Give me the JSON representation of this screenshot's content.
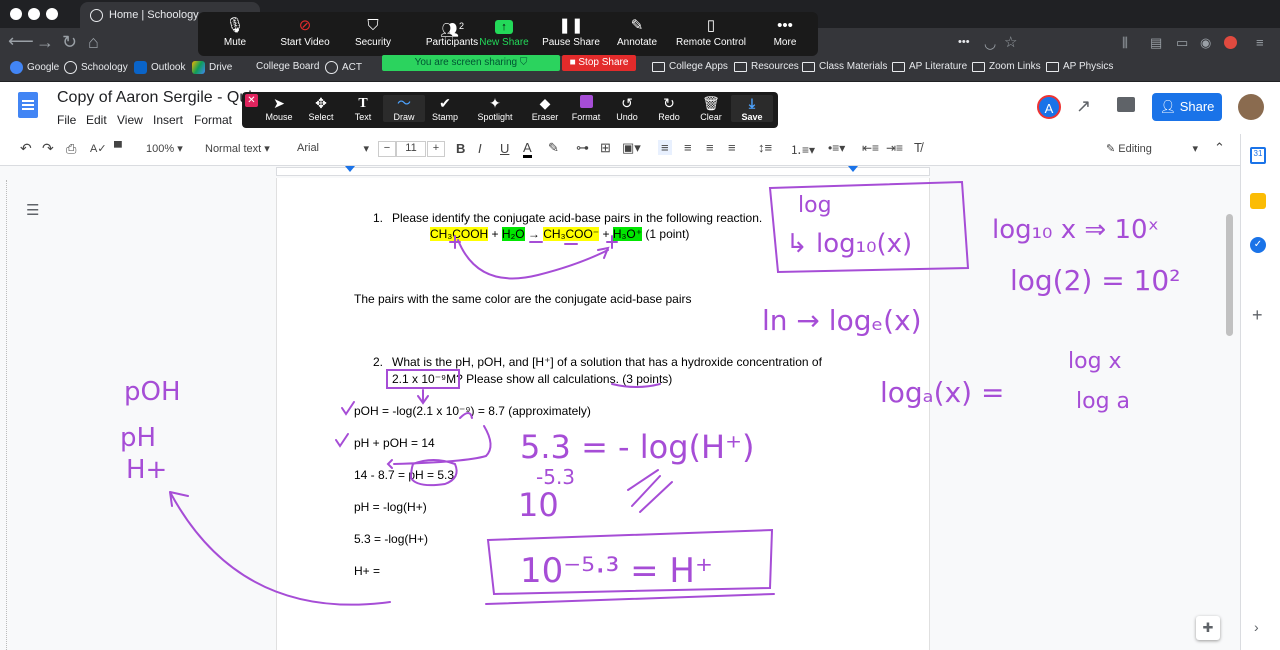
{
  "browser": {
    "tabs": [
      "Home | Schoology",
      "",
      ""
    ],
    "bookmarks": [
      "Google",
      "Schoology",
      "Outlook",
      "Drive",
      "College Board",
      "ACT",
      "College Apps",
      "Resources",
      "Class Materials",
      "AP Literature",
      "Zoom Links",
      "AP Physics"
    ],
    "more": "•••"
  },
  "zoom": {
    "buttons": [
      {
        "label": "Mute",
        "icon": "mic-icon"
      },
      {
        "label": "Start Video",
        "icon": "video-off-icon"
      },
      {
        "label": "Security",
        "icon": "shield-icon"
      },
      {
        "label": "Participants",
        "icon": "people-icon",
        "count": "2"
      },
      {
        "label": "New Share",
        "icon": "share-up-icon"
      },
      {
        "label": "Pause Share",
        "icon": "pause-icon"
      },
      {
        "label": "Annotate",
        "icon": "pen-icon"
      },
      {
        "label": "Remote Control",
        "icon": "mouse-icon"
      },
      {
        "label": "More",
        "icon": "more-icon"
      }
    ],
    "sharing_text": "You are screen sharing",
    "stop_share": "Stop Share",
    "annotate_tools": [
      "Mouse",
      "Select",
      "Text",
      "Draw",
      "Stamp",
      "Spotlight",
      "Eraser",
      "Format",
      "Undo",
      "Redo",
      "Clear",
      "Save"
    ]
  },
  "docs": {
    "title": "Copy of Aaron Sergile - Quiz",
    "menu": [
      "File",
      "Edit",
      "View",
      "Insert",
      "Format"
    ],
    "avatar_letter": "A",
    "share": "Share",
    "zoom": "100%",
    "style": "Normal text",
    "font": "Arial",
    "size": "11",
    "mode": "Editing"
  },
  "content": {
    "q1_num": "1.",
    "q1": "Please identify the conjugate acid-base pairs in the following reaction.",
    "eq": {
      "a": "CH₃COOH",
      "plus1": " + ",
      "b": "H₂O",
      "arrow": " → ",
      "c": "CH₃COO⁻",
      "plus2": " + ",
      "d": "H₃O⁺",
      "pts": " (1 point)"
    },
    "pairs": "The pairs with the same color are the conjugate acid-base pairs",
    "q2_num": "2.",
    "q2_line1": "What is the pH, pOH, and [H⁺] of a solution that has a hydroxide concentration of",
    "q2_line2": "2.1 x 10⁻⁹M? Please show all calculations. (3 points)",
    "lines": [
      "pOH = -log(2.1 x 10⁻⁹) = 8.7 (approximately)",
      "pH + pOH = 14",
      "14 - 8.7 = pH = 5.3",
      "pH = -log(H+)",
      "5.3 = -log(H+)",
      "H+ ="
    ]
  },
  "handwriting": {
    "log_box": "log",
    "log_box2": "↳ log₁₀(x)",
    "log10": "log₁₀ x ⇒ 10ˣ",
    "log2": "log(2) = 10²",
    "ln": "ln → logₑ(x)",
    "loga": "logₐ(x) =",
    "frac_top": "log x",
    "frac_bot": "log a",
    "left": [
      "pOH",
      "pH",
      "H+"
    ],
    "eq1": "5.3 = - log(H⁺)",
    "ten": "10",
    "neg53": "-5.3",
    "result": "10⁻⁵·³ = H⁺"
  },
  "colors": {
    "ink": "#a64dd6",
    "accent": "#1a73e8",
    "stop": "#e32b2b",
    "green": "#2bd35e"
  }
}
